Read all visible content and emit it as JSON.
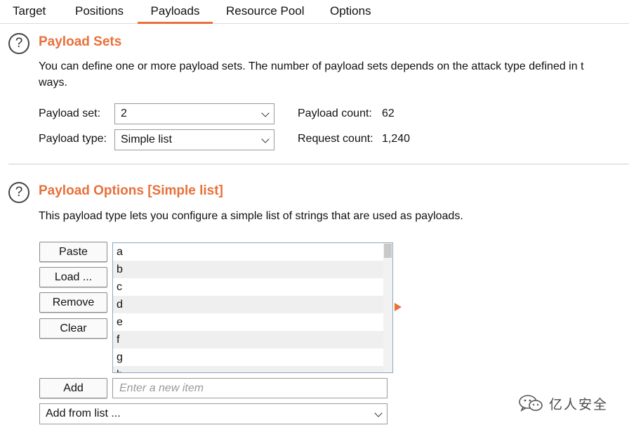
{
  "tabs": [
    {
      "label": "Target",
      "active": false
    },
    {
      "label": "Positions",
      "active": false
    },
    {
      "label": "Payloads",
      "active": true
    },
    {
      "label": "Resource Pool",
      "active": false
    },
    {
      "label": "Options",
      "active": false
    }
  ],
  "accent_color": "#e8703a",
  "payload_sets": {
    "help_icon": "question-mark-icon",
    "title": "Payload Sets",
    "description_line1": "You can define one or more payload sets. The number of payload sets depends on the attack type defined in t",
    "description_line2": "ways.",
    "payload_set_label": "Payload set:",
    "payload_set_value": "2",
    "payload_type_label": "Payload type:",
    "payload_type_value": "Simple list",
    "payload_count_label": "Payload count:",
    "payload_count_value": "62",
    "request_count_label": "Request count:",
    "request_count_value": "1,240"
  },
  "payload_options": {
    "help_icon": "question-mark-icon",
    "title": "Payload Options [Simple list]",
    "description": "This payload type lets you configure a simple list of strings that are used as payloads.",
    "buttons": {
      "paste": "Paste",
      "load": "Load ...",
      "remove": "Remove",
      "clear": "Clear",
      "add": "Add"
    },
    "list_items": [
      "a",
      "b",
      "c",
      "d",
      "e",
      "f",
      "g",
      "h"
    ],
    "new_item_placeholder": "Enter a new item",
    "add_from_list_value": "Add from list ..."
  },
  "watermark": {
    "text": "亿人安全",
    "icon": "wechat-logo-icon"
  }
}
